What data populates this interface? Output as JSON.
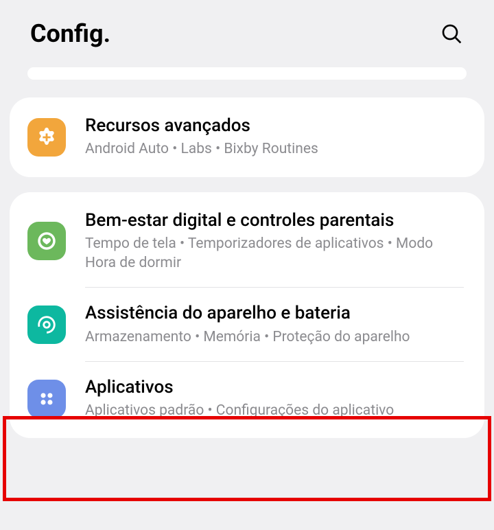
{
  "header": {
    "title": "Config."
  },
  "groups": [
    {
      "items": [
        {
          "icon_name": "plus-icon",
          "icon_color": "orange",
          "title": "Recursos avançados",
          "subtitle": "Android Auto  •  Labs  •  Bixby Routines"
        }
      ]
    },
    {
      "items": [
        {
          "icon_name": "heart-circle-icon",
          "icon_color": "green",
          "title": "Bem-estar digital e controles parentais",
          "subtitle": "Tempo de tela  •  Temporizadores de aplicativos  •  Modo Hora de dormir"
        },
        {
          "icon_name": "refresh-circle-icon",
          "icon_color": "teal",
          "title": "Assistência do aparelho e bateria",
          "subtitle": "Armazenamento  •  Memória  •  Proteção do aparelho"
        },
        {
          "icon_name": "apps-grid-icon",
          "icon_color": "blue",
          "title": "Aplicativos",
          "subtitle": "Aplicativos padrão  •  Configurações do aplicativo"
        }
      ]
    }
  ],
  "highlight": {
    "target_item_title": "Aplicativos",
    "color": "#e60000"
  }
}
